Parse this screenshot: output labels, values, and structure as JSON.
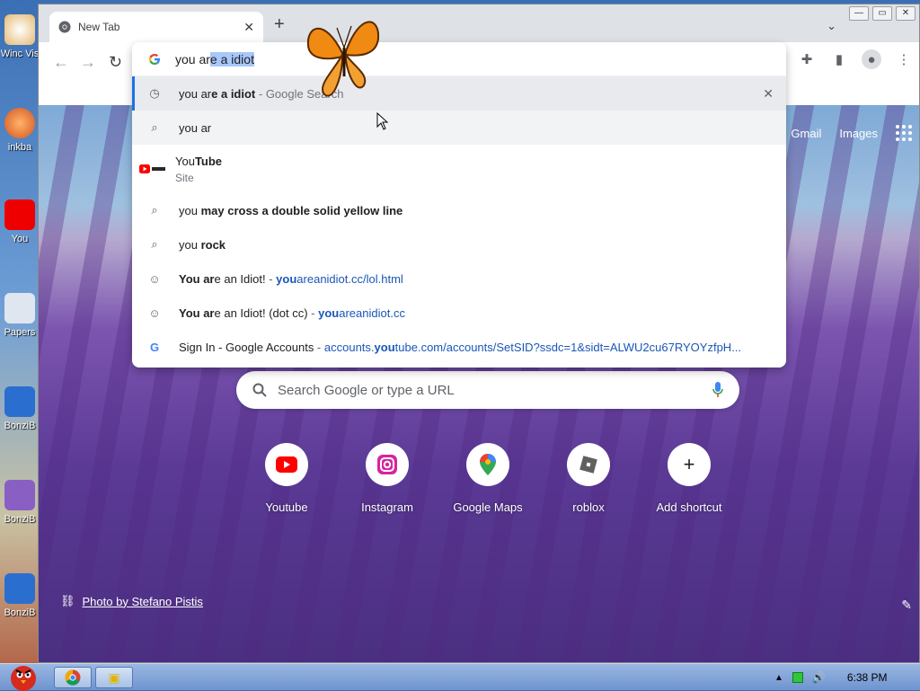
{
  "desktop": {
    "icons": [
      {
        "label": "Winc Vis"
      },
      {
        "label": "inkba"
      },
      {
        "label": "You"
      },
      {
        "label": "Papers"
      },
      {
        "label": "BonziB"
      },
      {
        "label": "BonziB"
      },
      {
        "label": "BonziB"
      }
    ]
  },
  "taskbar": {
    "clock": "6:38 PM"
  },
  "browser": {
    "tab_title": "New Tab",
    "omnibox": {
      "typed": "you ar",
      "autocomplete": "e a idiot",
      "suggestions": [
        {
          "icon": "history-icon",
          "parts": [
            {
              "t": "you ar",
              "b": false
            },
            {
              "t": "e a idiot",
              "b": true
            }
          ],
          "suffix": " - Google Search"
        },
        {
          "icon": "search-icon",
          "parts": [
            {
              "t": "you ar",
              "b": false
            }
          ]
        },
        {
          "icon": "youtube-icon",
          "parts": [
            {
              "t": "You",
              "b": false
            },
            {
              "t": "Tube",
              "b": true
            }
          ],
          "subtext": "Site"
        },
        {
          "icon": "search-icon",
          "parts": [
            {
              "t": "you ",
              "b": false
            },
            {
              "t": "may cross a double solid yellow line",
              "b": true
            }
          ]
        },
        {
          "icon": "search-icon",
          "parts": [
            {
              "t": "you ",
              "b": false
            },
            {
              "t": "rock",
              "b": true
            }
          ]
        },
        {
          "icon": "smiley-icon",
          "parts": [
            {
              "t": "You ar",
              "b": true
            },
            {
              "t": "e an Idiot!",
              "b": false
            }
          ],
          "url_parts": [
            {
              "t": "you",
              "b": true
            },
            {
              "t": "areanidiot.cc/lol.html",
              "b": false
            }
          ]
        },
        {
          "icon": "smiley-icon",
          "parts": [
            {
              "t": "You ar",
              "b": true
            },
            {
              "t": "e an Idiot! (dot cc)",
              "b": false
            }
          ],
          "url_parts": [
            {
              "t": "you",
              "b": true
            },
            {
              "t": "areanidiot.cc",
              "b": false
            }
          ]
        },
        {
          "icon": "google-icon",
          "parts": [
            {
              "t": "Sign In - Google Accounts",
              "b": false
            }
          ],
          "url_parts": [
            {
              "t": "accounts.",
              "b": false
            },
            {
              "t": "you",
              "b": true
            },
            {
              "t": "tube.com/accounts/SetSID?ssdc=1&sidt=ALWU2cu67RYOYzfpH...",
              "b": false
            }
          ]
        }
      ]
    }
  },
  "ntp": {
    "links": {
      "gmail": "Gmail",
      "images": "Images"
    },
    "search_placeholder": "Search Google or type a URL",
    "shortcuts": [
      {
        "name": "Youtube",
        "icon": "youtube-icon"
      },
      {
        "name": "Instagram",
        "icon": "instagram-icon"
      },
      {
        "name": "Google Maps",
        "icon": "maps-pin-icon"
      },
      {
        "name": "roblox",
        "icon": "roblox-icon"
      },
      {
        "name": "Add shortcut",
        "icon": "plus-icon"
      }
    ],
    "photo_credit": "Photo by Stefano Pistis"
  }
}
